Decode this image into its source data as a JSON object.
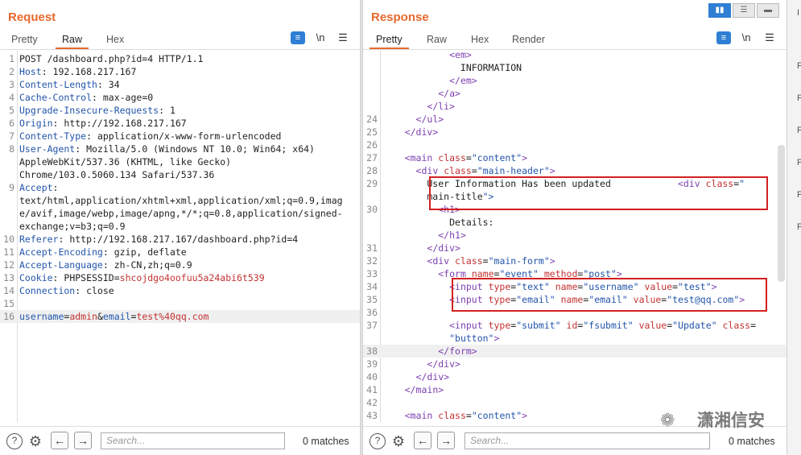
{
  "request": {
    "title": "Request",
    "tabs": [
      "Pretty",
      "Raw",
      "Hex"
    ],
    "active_tab": "Raw",
    "icons": {
      "wrap": "word-wrap-icon",
      "newline": "\\n",
      "menu": "hamburger-menu-icon"
    },
    "lines": [
      {
        "n": "1",
        "t": "POST /dashboard.php?id=4 HTTP/1.1"
      },
      {
        "n": "2",
        "k": "Host",
        "v": ": 192.168.217.167"
      },
      {
        "n": "3",
        "k": "Content-Length",
        "v": ": 34"
      },
      {
        "n": "4",
        "k": "Cache-Control",
        "v": ": max-age=0"
      },
      {
        "n": "5",
        "k": "Upgrade-Insecure-Requests",
        "v": ": 1"
      },
      {
        "n": "6",
        "k": "Origin",
        "v": ": http://192.168.217.167"
      },
      {
        "n": "7",
        "k": "Content-Type",
        "v": ": application/x-www-form-urlencoded"
      },
      {
        "n": "8",
        "k": "User-Agent",
        "v": ": Mozilla/5.0 (Windows NT 10.0; Win64; x64)"
      },
      {
        "n": "",
        "t": "AppleWebKit/537.36 (KHTML, like Gecko)"
      },
      {
        "n": "",
        "t": "Chrome/103.0.5060.134 Safari/537.36"
      },
      {
        "n": "9",
        "k": "Accept",
        "v": ":"
      },
      {
        "n": "",
        "t": "text/html,application/xhtml+xml,application/xml;q=0.9,imag"
      },
      {
        "n": "",
        "t": "e/avif,image/webp,image/apng,*/*;q=0.8,application/signed-"
      },
      {
        "n": "",
        "t": "exchange;v=b3;q=0.9"
      },
      {
        "n": "10",
        "k": "Referer",
        "v": ": http://192.168.217.167/dashboard.php?id=4"
      },
      {
        "n": "11",
        "k": "Accept-Encoding",
        "v": ": gzip, deflate"
      },
      {
        "n": "12",
        "k": "Accept-Language",
        "v": ": zh-CN,zh;q=0.9"
      },
      {
        "n": "13",
        "k": "Cookie",
        "v": ": PHPSESSID=",
        "c": "shcojdgo4oofuu5a24abi6t539"
      },
      {
        "n": "14",
        "k": "Connection",
        "v": ": close"
      },
      {
        "n": "15",
        "t": ""
      },
      {
        "n": "16",
        "body": [
          "username",
          "=",
          "admin",
          "&",
          "email",
          "=",
          "test%40qq.com"
        ]
      }
    ],
    "search_placeholder": "Search...",
    "matches": "0 matches"
  },
  "response": {
    "title": "Response",
    "tabs": [
      "Pretty",
      "Raw",
      "Hex",
      "Render"
    ],
    "active_tab": "Pretty",
    "lines": [
      {
        "n": "",
        "h": "            <em>"
      },
      {
        "n": "",
        "h": "              INFORMATION"
      },
      {
        "n": "",
        "h": "            </em>"
      },
      {
        "n": "",
        "h": "          </a>"
      },
      {
        "n": "",
        "h": "        </li>"
      },
      {
        "n": "24",
        "h": "      </ul>"
      },
      {
        "n": "25",
        "h": "    </div>"
      },
      {
        "n": "26",
        "h": ""
      },
      {
        "n": "27",
        "h": "    <main class=\"content\">"
      },
      {
        "n": "28",
        "h": "      <div class=\"main-header\">"
      },
      {
        "n": "29",
        "h": "        User Information Has been updated            <div class=\""
      },
      {
        "n": "",
        "h": "        main-title\">"
      },
      {
        "n": "30",
        "h": "          <h1>"
      },
      {
        "n": "",
        "h": "            Details:"
      },
      {
        "n": "",
        "h": "          </h1>"
      },
      {
        "n": "31",
        "h": "        </div>"
      },
      {
        "n": "32",
        "h": "        <div class=\"main-form\">"
      },
      {
        "n": "33",
        "h": "          <form name=\"event\" method=\"post\">"
      },
      {
        "n": "34",
        "h": "            <input type=\"text\" name=\"username\" value=\"test\">"
      },
      {
        "n": "35",
        "h": "            <input type=\"email\" name=\"email\" value=\"test@qq.com\">"
      },
      {
        "n": "36",
        "h": ""
      },
      {
        "n": "37",
        "h": "            <input type=\"submit\" id=\"fsubmit\" value=\"Update\" class="
      },
      {
        "n": "",
        "h": "            \"button\">"
      },
      {
        "n": "38",
        "h": "          </form>"
      },
      {
        "n": "39",
        "h": "        </div>"
      },
      {
        "n": "40",
        "h": "      </div>"
      },
      {
        "n": "41",
        "h": "    </main>"
      },
      {
        "n": "42",
        "h": ""
      },
      {
        "n": "43",
        "h": "    <main class=\"content\">"
      }
    ],
    "search_placeholder": "Search...",
    "matches": "0 matches"
  },
  "right_strip": [
    "I",
    "F",
    "F",
    "F",
    "F",
    "F",
    "F"
  ],
  "watermark": "潇湘信安",
  "colors": {
    "accent": "#e8692d",
    "highlight_box": "#d41f1f",
    "toggle": "#2f7fd4"
  }
}
